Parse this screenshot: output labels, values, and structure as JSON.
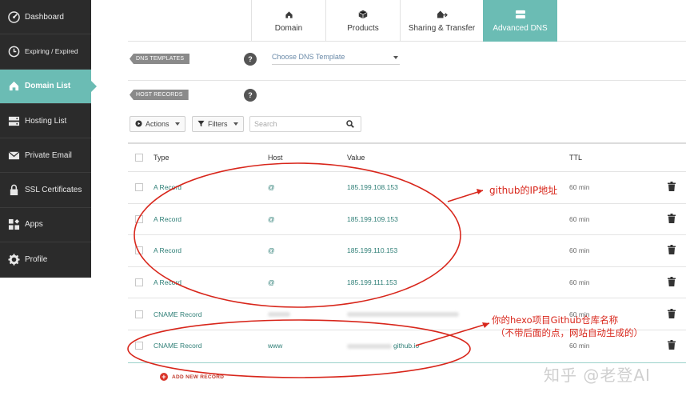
{
  "sidebar": {
    "items": [
      {
        "label": "Dashboard",
        "icon": "dashboard-icon"
      },
      {
        "label": "Expiring / Expired",
        "icon": "clock-icon"
      },
      {
        "label": "Domain List",
        "icon": "home-icon",
        "active": true
      },
      {
        "label": "Hosting List",
        "icon": "server-icon"
      },
      {
        "label": "Private Email",
        "icon": "envelope-icon"
      },
      {
        "label": "SSL Certificates",
        "icon": "lock-icon"
      },
      {
        "label": "Apps",
        "icon": "apps-icon"
      },
      {
        "label": "Profile",
        "icon": "gear-icon"
      }
    ]
  },
  "tabs": [
    {
      "label": "Domain",
      "icon": "home-icon"
    },
    {
      "label": "Products",
      "icon": "box-icon"
    },
    {
      "label": "Sharing & Transfer",
      "icon": "transfer-icon"
    },
    {
      "label": "Advanced DNS",
      "icon": "dns-icon",
      "active": true
    }
  ],
  "dns_templates": {
    "label": "DNS TEMPLATES",
    "help": "?",
    "select_value": "Choose DNS Template"
  },
  "host_records": {
    "label": "HOST RECORDS",
    "help": "?"
  },
  "toolbar": {
    "actions_label": "Actions",
    "filters_label": "Filters",
    "search_placeholder": "Search"
  },
  "table": {
    "headers": {
      "type": "Type",
      "host": "Host",
      "value": "Value",
      "ttl": "TTL"
    },
    "rows": [
      {
        "type": "A Record",
        "host": "@",
        "value": "185.199.108.153",
        "ttl": "60 min"
      },
      {
        "type": "A Record",
        "host": "@",
        "value": "185.199.109.153",
        "ttl": "60 min"
      },
      {
        "type": "A Record",
        "host": "@",
        "value": "185.199.110.153",
        "ttl": "60 min"
      },
      {
        "type": "A Record",
        "host": "@",
        "value": "185.199.111.153",
        "ttl": "60 min"
      },
      {
        "type": "CNAME Record",
        "host": "",
        "value": "",
        "ttl": "60 min"
      },
      {
        "type": "CNAME Record",
        "host": "www",
        "value": "github.io",
        "ttl": "60 min"
      }
    ],
    "add_label": "ADD NEW RECORD"
  },
  "annotations": {
    "ip_note": "github的IP地址",
    "repo_note_line1": "你的hexo项目Github仓库名称",
    "repo_note_line2": "（不带后面的点，网站自动生成的）"
  },
  "watermark": "知乎 @老登AI",
  "colors": {
    "accent": "#6bbcb4",
    "sidebar": "#2b2b2b",
    "annotation": "#d8261b"
  }
}
